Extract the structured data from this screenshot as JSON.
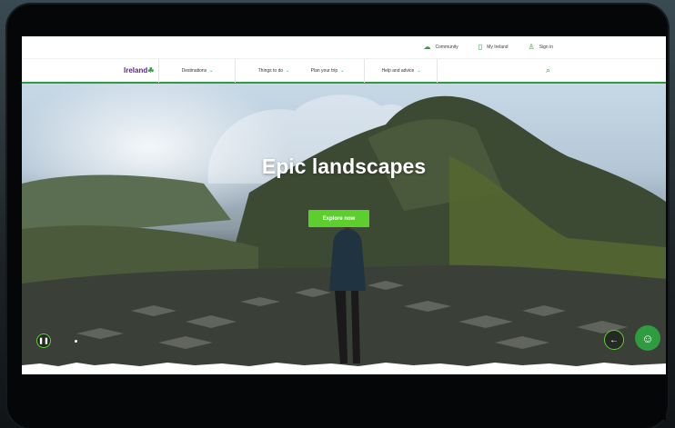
{
  "utility_bar": {
    "community": "Community",
    "my_ireland": "My Ireland",
    "sign_in": "Sign in"
  },
  "nav": {
    "logo": "Ireland",
    "items": [
      {
        "label": "Destinations"
      },
      {
        "label": "Things to do"
      },
      {
        "label": "Plan your trip"
      },
      {
        "label": "Help and advice"
      }
    ],
    "chevron": "⌄"
  },
  "hero": {
    "title": "Epic landscapes",
    "cta": "Explore now"
  },
  "icons": {
    "community": "community-icon",
    "my_ireland": "bookmark-icon",
    "sign_in": "user-icon",
    "search": "search-icon",
    "pause": "pause-icon",
    "prev": "arrow-left-icon",
    "chat": "chat-assistant-icon"
  },
  "colors": {
    "brand_green": "#2e9c3f",
    "cta_green": "#5ccf2e",
    "logo_purple": "#5b2a86"
  }
}
